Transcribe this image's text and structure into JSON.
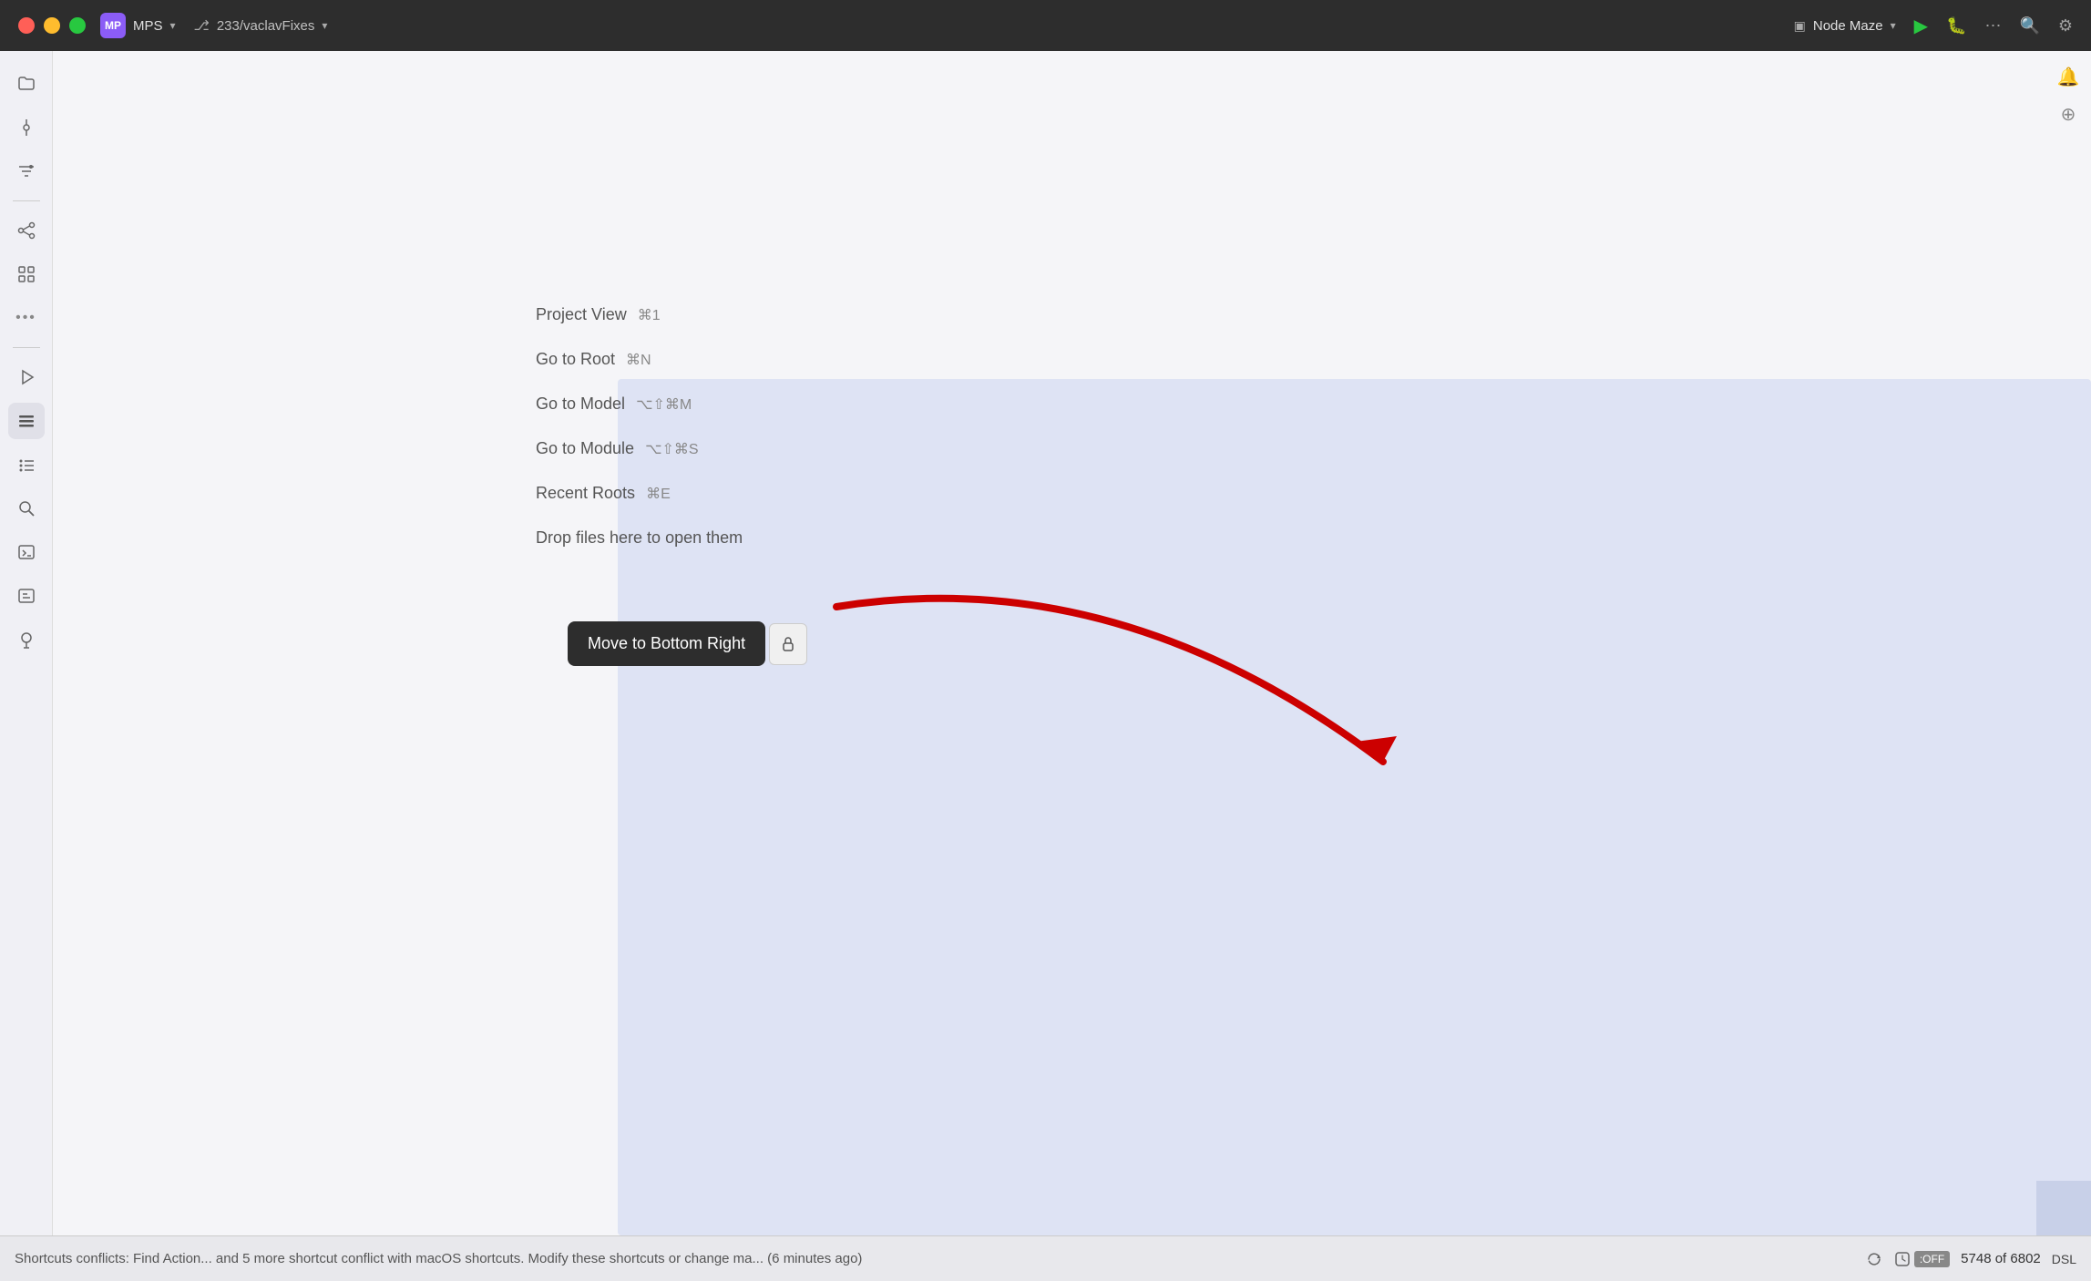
{
  "titlebar": {
    "app_name": "MPS",
    "app_initials": "MP",
    "branch": "233/vaclavFixes",
    "node_maze": "Node Maze",
    "more_label": "⋯"
  },
  "sidebar": {
    "icons": [
      {
        "name": "folder",
        "glyph": "📁",
        "active": false
      },
      {
        "name": "commit",
        "glyph": "◎",
        "active": false
      },
      {
        "name": "filter",
        "glyph": "≡",
        "active": false
      },
      {
        "name": "graph",
        "glyph": "⎇",
        "active": false
      },
      {
        "name": "grid",
        "glyph": "⊞",
        "active": false
      },
      {
        "name": "more",
        "glyph": "•••",
        "active": false
      },
      {
        "name": "run",
        "glyph": "▶",
        "active": false
      },
      {
        "name": "list",
        "glyph": "☰",
        "active": true
      },
      {
        "name": "bullet-list",
        "glyph": "≡",
        "active": false
      },
      {
        "name": "search",
        "glyph": "🔍",
        "active": false
      },
      {
        "name": "terminal",
        "glyph": ">_",
        "active": false
      },
      {
        "name": "terminal2",
        "glyph": ">_",
        "active": false
      },
      {
        "name": "pin",
        "glyph": "⊕",
        "active": false
      }
    ]
  },
  "menu": {
    "items": [
      {
        "label": "Project View",
        "shortcut": "⌘1"
      },
      {
        "label": "Go to Root",
        "shortcut": "⌘N"
      },
      {
        "label": "Go to Model",
        "shortcut": "⌥⇧⌘M"
      },
      {
        "label": "Go to Module",
        "shortcut": "⌥⇧⌘S"
      },
      {
        "label": "Recent Roots",
        "shortcut": "⌘E"
      },
      {
        "label": "Drop files here to open them",
        "shortcut": ""
      }
    ]
  },
  "tooltip": {
    "button_label": "Move to Bottom Right",
    "icon_label": "🔒"
  },
  "statusbar": {
    "message": "Shortcuts conflicts: Find Action... and 5 more shortcut conflict with macOS shortcuts. Modify these shortcuts or change ma... (6 minutes ago)",
    "sync_icon": "⇄",
    "off_label": ":OFF",
    "count": "5748 of 6802",
    "dsl_label": "DSL"
  }
}
